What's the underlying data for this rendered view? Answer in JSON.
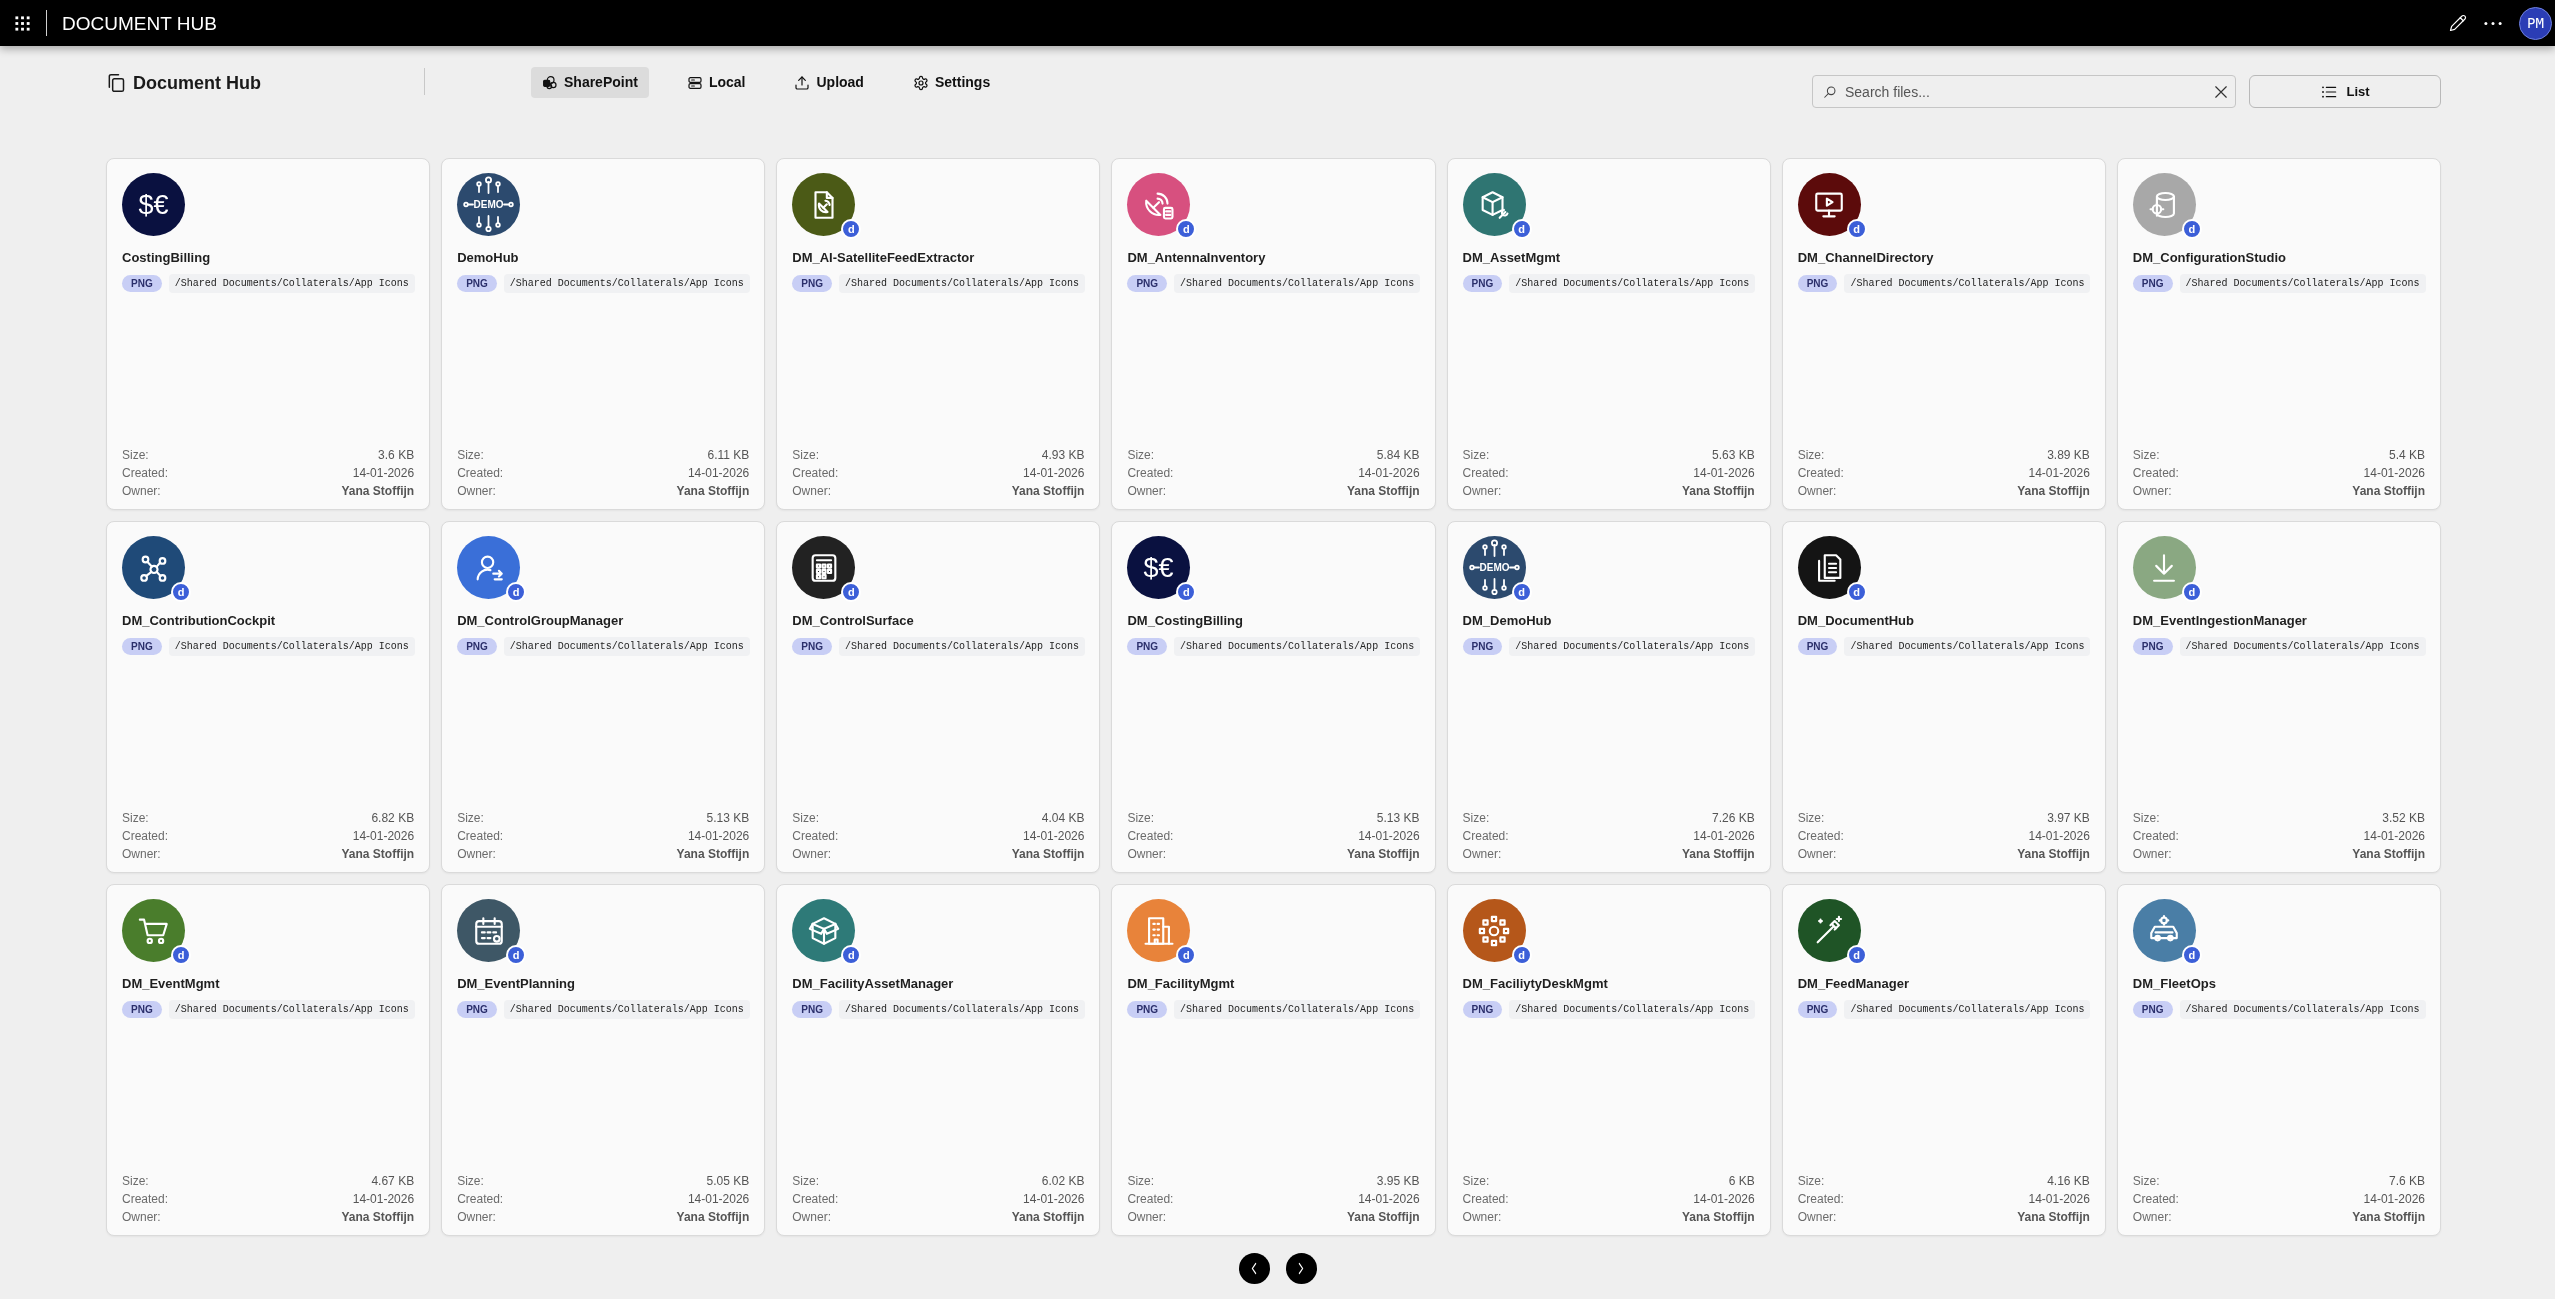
{
  "top_bar": {
    "title": "DOCUMENT HUB",
    "avatar": "PM"
  },
  "header": {
    "title": "Document Hub",
    "tabs": [
      {
        "label": "SharePoint",
        "selected": true
      },
      {
        "label": "Local",
        "selected": false
      },
      {
        "label": "Upload",
        "selected": false
      },
      {
        "label": "Settings",
        "selected": false
      }
    ],
    "search": {
      "placeholder": "Search files..."
    },
    "view_button": "List"
  },
  "files": [
    {
      "name": "CostingBilling",
      "thumbnail_text": "$€",
      "color": "#0a1140",
      "type": "PNG",
      "path": "/Shared Documents/Collaterals/App Icons",
      "details": [
        {
          "label": "Size:",
          "value": "3.6 KB"
        },
        {
          "label": "Created:",
          "value": "14-01-2026"
        },
        {
          "label": "Owner:",
          "value": "Yana Stoffijn"
        }
      ]
    },
    {
      "name": "DemoHub",
      "thumbnail_text": "DEMO",
      "color": "#2c4a6e",
      "type": "PNG",
      "path": "/Shared Documents/Collaterals/App Icons",
      "details": [
        {
          "label": "Size:",
          "value": "6.11 KB"
        },
        {
          "label": "Created:",
          "value": "14-01-2026"
        },
        {
          "label": "Owner:",
          "value": "Yana Stoffijn"
        }
      ]
    },
    {
      "name": "DM_AI-SatelliteFeedExtractor",
      "color": "#4b5a16",
      "badge": "d",
      "type": "PNG",
      "path": "/Shared Documents/Collaterals/App Icons",
      "details": [
        {
          "label": "Size:",
          "value": "4.93 KB"
        },
        {
          "label": "Created:",
          "value": "14-01-2026"
        },
        {
          "label": "Owner:",
          "value": "Yana Stoffijn"
        }
      ]
    },
    {
      "name": "DM_AntennaInventory",
      "color": "#d7507f",
      "badge": "d",
      "type": "PNG",
      "path": "/Shared Documents/Collaterals/App Icons",
      "details": [
        {
          "label": "Size:",
          "value": "5.84 KB"
        },
        {
          "label": "Created:",
          "value": "14-01-2026"
        },
        {
          "label": "Owner:",
          "value": "Yana Stoffijn"
        }
      ]
    },
    {
      "name": "DM_AssetMgmt",
      "color": "#2f7572",
      "badge": "d",
      "type": "PNG",
      "path": "/Shared Documents/Collaterals/App Icons",
      "details": [
        {
          "label": "Size:",
          "value": "5.63 KB"
        },
        {
          "label": "Created:",
          "value": "14-01-2026"
        },
        {
          "label": "Owner:",
          "value": "Yana Stoffijn"
        }
      ]
    },
    {
      "name": "DM_ChannelDirectory",
      "color": "#5c0b0b",
      "badge": "d",
      "type": "PNG",
      "path": "/Shared Documents/Collaterals/App Icons",
      "details": [
        {
          "label": "Size:",
          "value": "3.89 KB"
        },
        {
          "label": "Created:",
          "value": "14-01-2026"
        },
        {
          "label": "Owner:",
          "value": "Yana Stoffijn"
        }
      ]
    },
    {
      "name": "DM_ConfigurationStudio",
      "color": "#a8a8a8",
      "badge": "d",
      "type": "PNG",
      "path": "/Shared Documents/Collaterals/App Icons",
      "details": [
        {
          "label": "Size:",
          "value": "5.4 KB"
        },
        {
          "label": "Created:",
          "value": "14-01-2026"
        },
        {
          "label": "Owner:",
          "value": "Yana Stoffijn"
        }
      ]
    },
    {
      "name": "DM_ContributionCockpit",
      "color": "#1f4a78",
      "badge": "d",
      "type": "PNG",
      "path": "/Shared Documents/Collaterals/App Icons",
      "details": [
        {
          "label": "Size:",
          "value": "6.82 KB"
        },
        {
          "label": "Created:",
          "value": "14-01-2026"
        },
        {
          "label": "Owner:",
          "value": "Yana Stoffijn"
        }
      ]
    },
    {
      "name": "DM_ControlGroupManager",
      "color": "#3a6fd8",
      "badge": "d",
      "type": "PNG",
      "path": "/Shared Documents/Collaterals/App Icons",
      "details": [
        {
          "label": "Size:",
          "value": "5.13 KB"
        },
        {
          "label": "Created:",
          "value": "14-01-2026"
        },
        {
          "label": "Owner:",
          "value": "Yana Stoffijn"
        }
      ]
    },
    {
      "name": "DM_ControlSurface",
      "color": "#222222",
      "badge": "d",
      "type": "PNG",
      "path": "/Shared Documents/Collaterals/App Icons",
      "details": [
        {
          "label": "Size:",
          "value": "4.04 KB"
        },
        {
          "label": "Created:",
          "value": "14-01-2026"
        },
        {
          "label": "Owner:",
          "value": "Yana Stoffijn"
        }
      ]
    },
    {
      "name": "DM_CostingBilling",
      "thumbnail_text": "$€",
      "color": "#0a1140",
      "badge": "d",
      "type": "PNG",
      "path": "/Shared Documents/Collaterals/App Icons",
      "details": [
        {
          "label": "Size:",
          "value": "5.13 KB"
        },
        {
          "label": "Created:",
          "value": "14-01-2026"
        },
        {
          "label": "Owner:",
          "value": "Yana Stoffijn"
        }
      ]
    },
    {
      "name": "DM_DemoHub",
      "thumbnail_text": "DEMO",
      "color": "#2c4a6e",
      "badge": "d",
      "type": "PNG",
      "path": "/Shared Documents/Collaterals/App Icons",
      "details": [
        {
          "label": "Size:",
          "value": "7.26 KB"
        },
        {
          "label": "Created:",
          "value": "14-01-2026"
        },
        {
          "label": "Owner:",
          "value": "Yana Stoffijn"
        }
      ]
    },
    {
      "name": "DM_DocumentHub",
      "color": "#141414",
      "badge": "d",
      "type": "PNG",
      "path": "/Shared Documents/Collaterals/App Icons",
      "details": [
        {
          "label": "Size:",
          "value": "3.97 KB"
        },
        {
          "label": "Created:",
          "value": "14-01-2026"
        },
        {
          "label": "Owner:",
          "value": "Yana Stoffijn"
        }
      ]
    },
    {
      "name": "DM_EventIngestionManager",
      "color": "#8aa882",
      "badge": "d",
      "type": "PNG",
      "path": "/Shared Documents/Collaterals/App Icons",
      "details": [
        {
          "label": "Size:",
          "value": "3.52 KB"
        },
        {
          "label": "Created:",
          "value": "14-01-2026"
        },
        {
          "label": "Owner:",
          "value": "Yana Stoffijn"
        }
      ]
    },
    {
      "name": "DM_EventMgmt",
      "color": "#4a7d2c",
      "badge": "d",
      "type": "PNG",
      "path": "/Shared Documents/Collaterals/App Icons",
      "details": [
        {
          "label": "Size:",
          "value": "4.67 KB"
        },
        {
          "label": "Created:",
          "value": "14-01-2026"
        },
        {
          "label": "Owner:",
          "value": "Yana Stoffijn"
        }
      ]
    },
    {
      "name": "DM_EventPlanning",
      "color": "#3e5766",
      "badge": "d",
      "type": "PNG",
      "path": "/Shared Documents/Collaterals/App Icons",
      "details": [
        {
          "label": "Size:",
          "value": "5.05 KB"
        },
        {
          "label": "Created:",
          "value": "14-01-2026"
        },
        {
          "label": "Owner:",
          "value": "Yana Stoffijn"
        }
      ]
    },
    {
      "name": "DM_FacilityAssetManager",
      "color": "#2e7a78",
      "badge": "d",
      "type": "PNG",
      "path": "/Shared Documents/Collaterals/App Icons",
      "details": [
        {
          "label": "Size:",
          "value": "6.02 KB"
        },
        {
          "label": "Created:",
          "value": "14-01-2026"
        },
        {
          "label": "Owner:",
          "value": "Yana Stoffijn"
        }
      ]
    },
    {
      "name": "DM_FacilityMgmt",
      "color": "#e8833a",
      "badge": "d",
      "type": "PNG",
      "path": "/Shared Documents/Collaterals/App Icons",
      "details": [
        {
          "label": "Size:",
          "value": "3.95 KB"
        },
        {
          "label": "Created:",
          "value": "14-01-2026"
        },
        {
          "label": "Owner:",
          "value": "Yana Stoffijn"
        }
      ]
    },
    {
      "name": "DM_FaciliytyDeskMgmt",
      "color": "#b5571a",
      "badge": "d",
      "type": "PNG",
      "path": "/Shared Documents/Collaterals/App Icons",
      "details": [
        {
          "label": "Size:",
          "value": "6 KB"
        },
        {
          "label": "Created:",
          "value": "14-01-2026"
        },
        {
          "label": "Owner:",
          "value": "Yana Stoffijn"
        }
      ]
    },
    {
      "name": "DM_FeedManager",
      "color": "#1f5426",
      "badge": "d",
      "type": "PNG",
      "path": "/Shared Documents/Collaterals/App Icons",
      "details": [
        {
          "label": "Size:",
          "value": "4.16 KB"
        },
        {
          "label": "Created:",
          "value": "14-01-2026"
        },
        {
          "label": "Owner:",
          "value": "Yana Stoffijn"
        }
      ]
    },
    {
      "name": "DM_FleetOps",
      "color": "#4a7ea6",
      "badge": "d",
      "type": "PNG",
      "path": "/Shared Documents/Collaterals/App Icons",
      "details": [
        {
          "label": "Size:",
          "value": "7.6 KB"
        },
        {
          "label": "Created:",
          "value": "14-01-2026"
        },
        {
          "label": "Owner:",
          "value": "Yana Stoffijn"
        }
      ]
    }
  ]
}
